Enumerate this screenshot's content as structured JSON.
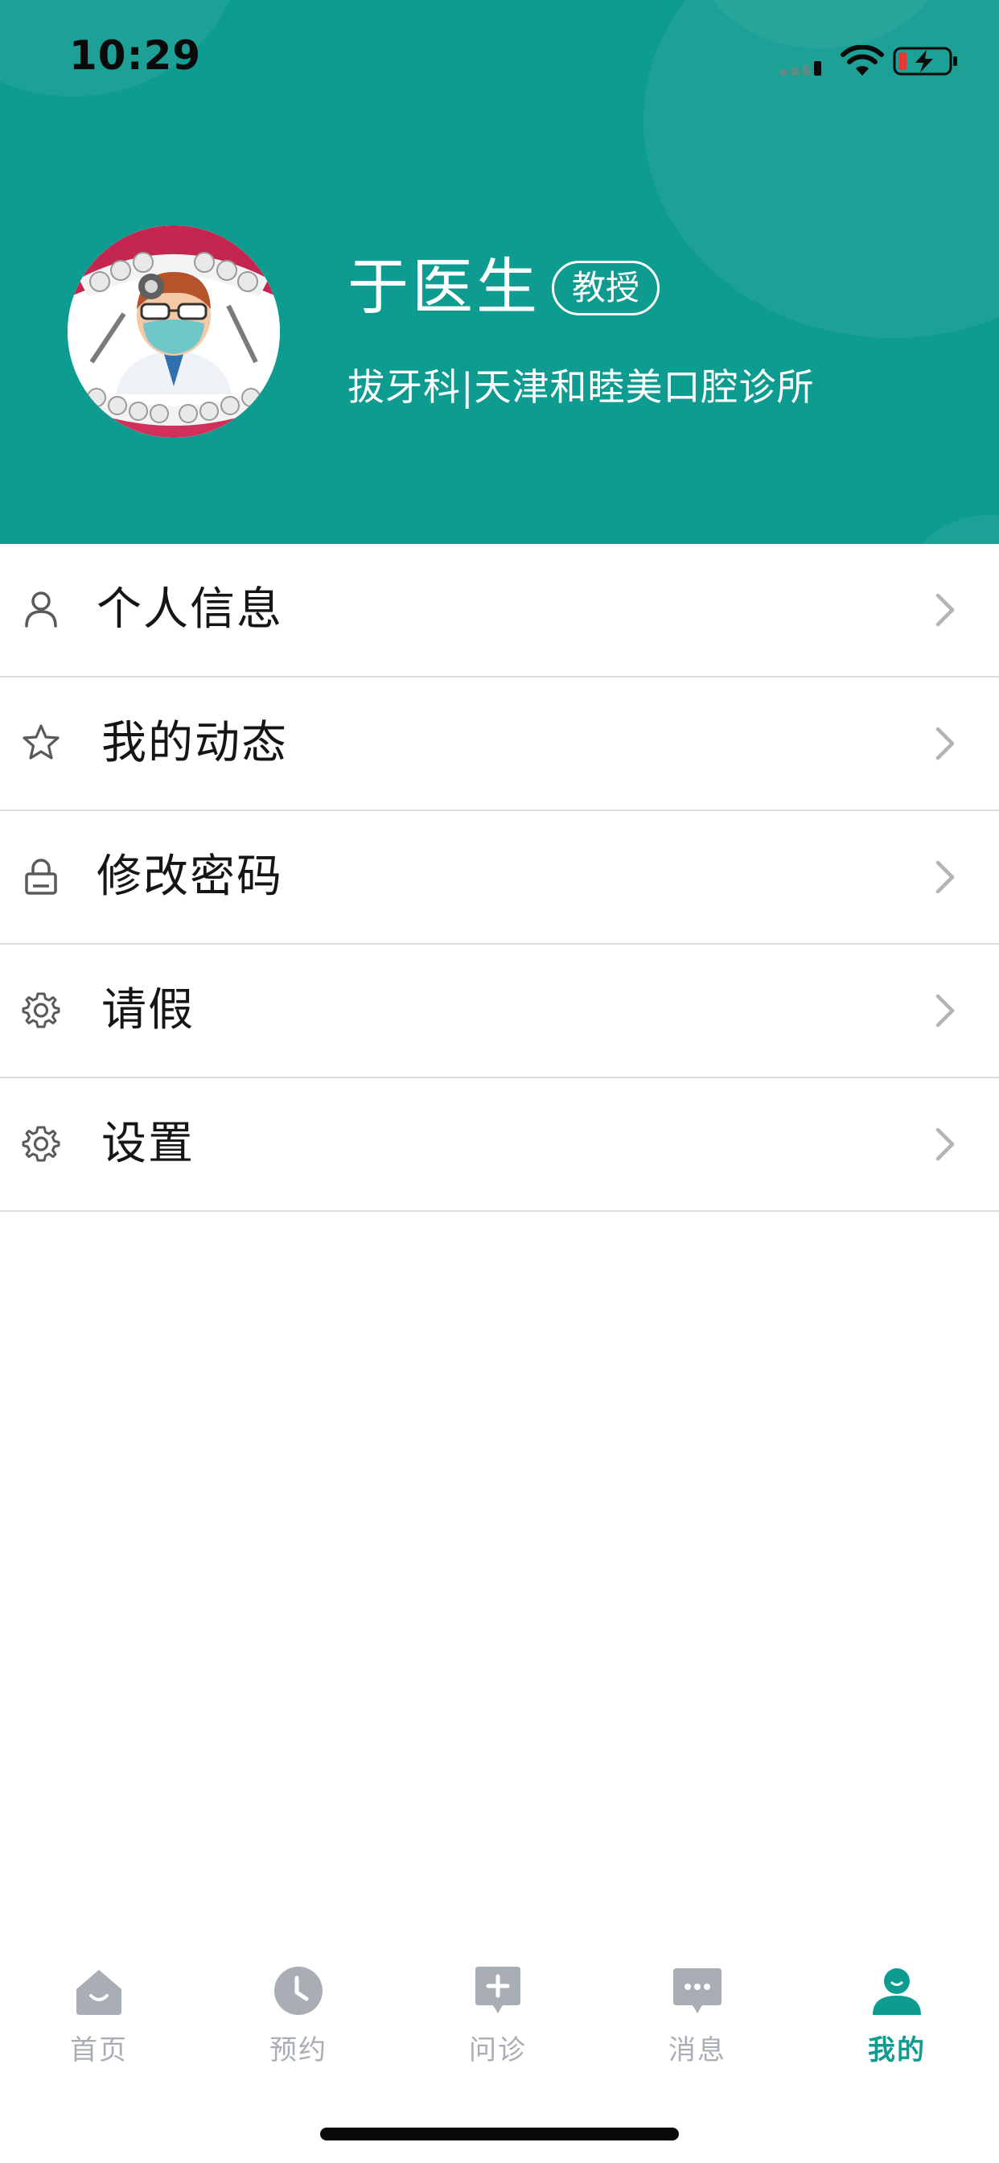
{
  "status_bar": {
    "time": "10:29"
  },
  "profile": {
    "name": "于医生",
    "title_badge": "教授",
    "department_line": "拔牙科|天津和睦美口腔诊所",
    "accent_color": "#0f9c90"
  },
  "menu": {
    "items": [
      {
        "label": "个人信息",
        "icon": "person-icon"
      },
      {
        "label": "我的动态",
        "icon": "star-icon"
      },
      {
        "label": "修改密码",
        "icon": "lock-icon"
      },
      {
        "label": "请假",
        "icon": "gear-icon"
      },
      {
        "label": "设置",
        "icon": "gear-icon"
      }
    ]
  },
  "tabbar": {
    "active_color": "#0f9c90",
    "inactive_color": "#a9aeb4",
    "tabs": [
      {
        "label": "首页",
        "icon": "home-icon",
        "active": false
      },
      {
        "label": "预约",
        "icon": "clock-icon",
        "active": false
      },
      {
        "label": "问诊",
        "icon": "consult-icon",
        "active": false
      },
      {
        "label": "消息",
        "icon": "message-icon",
        "active": false
      },
      {
        "label": "我的",
        "icon": "profile-icon",
        "active": true
      }
    ]
  }
}
